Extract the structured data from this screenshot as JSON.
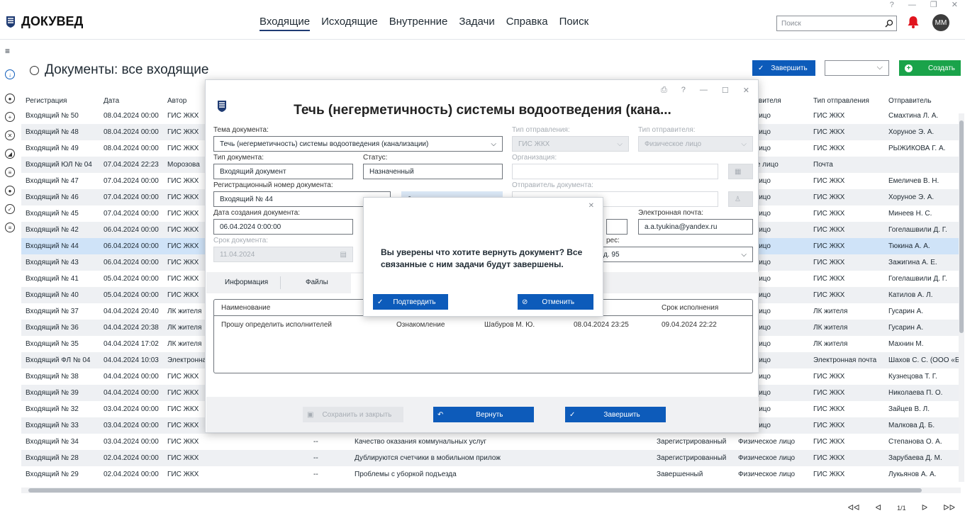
{
  "window": {
    "help": "?",
    "minimize": "—",
    "restore": "❐",
    "close": "✕"
  },
  "app": {
    "title": "ДОКУВЕД"
  },
  "nav": [
    "Входящие",
    "Исходящие",
    "Внутренние",
    "Задачи",
    "Справка",
    "Поиск"
  ],
  "search": {
    "placeholder": "Поиск"
  },
  "user": {
    "initials": "ММ"
  },
  "page": {
    "title": "Документы: все входящие"
  },
  "toolbar": {
    "finish_label": "Завершить",
    "create_label": "Создать"
  },
  "table": {
    "headers": [
      "Регистрация",
      "Дата",
      "Автор",
      "",
      "",
      "",
      "",
      "Отправителя",
      "Тип отправления",
      "Отправитель"
    ],
    "rows": [
      [
        "Входящий № 50",
        "08.04.2024 00:00",
        "ГИС ЖКХ",
        "",
        "",
        "",
        "",
        "ское лицо",
        "ГИС ЖКХ",
        "Смахтина Л. А."
      ],
      [
        "Входящий № 48",
        "08.04.2024 00:00",
        "ГИС ЖКХ",
        "",
        "",
        "",
        "",
        "ское лицо",
        "ГИС ЖКХ",
        "Хоруное Э. А."
      ],
      [
        "Входящий № 49",
        "08.04.2024 00:00",
        "ГИС ЖКХ",
        "",
        "",
        "",
        "",
        "ское лицо",
        "ГИС ЖКХ",
        "РЫЖИКОВА Г. А."
      ],
      [
        "Входящий ЮЛ № 04",
        "07.04.2024 22:23",
        "Морозова",
        "",
        "",
        "",
        "",
        "ческое лицо",
        "Почта",
        ""
      ],
      [
        "Входящий № 47",
        "07.04.2024 00:00",
        "ГИС ЖКХ",
        "",
        "",
        "",
        "",
        "ское лицо",
        "ГИС ЖКХ",
        "Емеличев В. Н."
      ],
      [
        "Входящий № 46",
        "07.04.2024 00:00",
        "ГИС ЖКХ",
        "",
        "",
        "",
        "",
        "ское лицо",
        "ГИС ЖКХ",
        "Хоруное Э. А."
      ],
      [
        "Входящий № 45",
        "07.04.2024 00:00",
        "ГИС ЖКХ",
        "",
        "",
        "",
        "",
        "ское лицо",
        "ГИС ЖКХ",
        "Минеев Н. С."
      ],
      [
        "Входящий № 42",
        "06.04.2024 00:00",
        "ГИС ЖКХ",
        "",
        "",
        "",
        "",
        "ское лицо",
        "ГИС ЖКХ",
        "Гогелашвили Д. Г."
      ],
      [
        "Входящий № 44",
        "06.04.2024 00:00",
        "ГИС ЖКХ",
        "",
        "",
        "",
        "",
        "ское лицо",
        "ГИС ЖКХ",
        "Тюкина А. А."
      ],
      [
        "Входящий № 43",
        "06.04.2024 00:00",
        "ГИС ЖКХ",
        "",
        "",
        "",
        "",
        "ское лицо",
        "ГИС ЖКХ",
        "Зажигина А. Е."
      ],
      [
        "Входящий № 41",
        "05.04.2024 00:00",
        "ГИС ЖКХ",
        "",
        "",
        "",
        "",
        "ское лицо",
        "ГИС ЖКХ",
        "Гогелашвили Д. Г."
      ],
      [
        "Входящий № 40",
        "05.04.2024 00:00",
        "ГИС ЖКХ",
        "",
        "",
        "",
        "",
        "ское лицо",
        "ГИС ЖКХ",
        "Катилов А. Л."
      ],
      [
        "Входящий № 37",
        "04.04.2024 20:40",
        "ЛК жителя",
        "",
        "",
        "",
        "",
        "ское лицо",
        "ЛК жителя",
        "Гусарин А."
      ],
      [
        "Входящий № 36",
        "04.04.2024 20:38",
        "ЛК жителя",
        "",
        "",
        "",
        "",
        "ское лицо",
        "ЛК жителя",
        "Гусарин А."
      ],
      [
        "Входящий № 35",
        "04.04.2024 17:02",
        "ЛК жителя",
        "",
        "",
        "",
        "",
        "ское лицо",
        "ЛК жителя",
        "Махнин М."
      ],
      [
        "Входящий ФЛ № 04",
        "04.04.2024 10:03",
        "Электронна",
        "",
        "",
        "",
        "",
        "ское лицо",
        "Электронная почта",
        "Шахов С. С. (ООО «Б"
      ],
      [
        "Входящий № 38",
        "04.04.2024 00:00",
        "ГИС ЖКХ",
        "",
        "",
        "",
        "",
        "ское лицо",
        "ГИС ЖКХ",
        "Кузнецова Т. Г."
      ],
      [
        "Входящий № 39",
        "04.04.2024 00:00",
        "ГИС ЖКХ",
        "",
        "",
        "",
        "",
        "ское лицо",
        "ГИС ЖКХ",
        "Николаева П. О."
      ],
      [
        "Входящий № 32",
        "03.04.2024 00:00",
        "ГИС ЖКХ",
        "",
        "",
        "",
        "",
        "ское лицо",
        "ГИС ЖКХ",
        "Зайцев В. Л."
      ],
      [
        "Входящий № 33",
        "03.04.2024 00:00",
        "ГИС ЖКХ",
        "",
        "",
        "",
        "",
        "ское лицо",
        "ГИС ЖКХ",
        "Малкова Д. Б."
      ],
      [
        "Входящий № 34",
        "03.04.2024 00:00",
        "ГИС ЖКХ",
        "",
        "--",
        "Качество оказания коммунальных услуг",
        "Зарегистрированный",
        "Физическое лицо",
        "ГИС ЖКХ",
        "Степанова О. А."
      ],
      [
        "Входящий № 28",
        "02.04.2024 00:00",
        "ГИС ЖКХ",
        "",
        "--",
        "Дублируются счетчики в мобильном прилож",
        "Зарегистрированный",
        "Физическое лицо",
        "ГИС ЖКХ",
        "Зарубаева Д. М."
      ],
      [
        "Входящий № 29",
        "02.04.2024 00:00",
        "ГИС ЖКХ",
        "",
        "--",
        "Проблемы с уборкой подъезда",
        "Завершенный",
        "Физическое лицо",
        "ГИС ЖКХ",
        "Лукьянов А. А."
      ]
    ]
  },
  "pager": {
    "first": "ᐊᐊ",
    "prev": "ᐊ",
    "current": "1/1",
    "next": "ᐅ",
    "last": "ᐅᐅ"
  },
  "doc": {
    "title": "Течь (негерметичность) системы водоотведения (кана...",
    "subject_label": "Тема документа:",
    "subject_value": "Течь (негерметичность) системы водоотведения (канализации)",
    "doctype_label": "Тип документа:",
    "doctype_value": "Входящий документ",
    "status_label": "Статус:",
    "status_value": "Назначенный",
    "regnum_label": "Регистрационный номер документа:",
    "regnum_value": "Входящий № 44",
    "created_label": "Дата создания документа:",
    "created_value": "06.04.2024 0:00:00",
    "deadline_label": "Срок документа:",
    "deadline_value": "11.04.2024",
    "send_type_label": "Тип отправления:",
    "send_type_value": "ГИС ЖКХ",
    "sender_type_label": "Тип отправителя:",
    "sender_type_value": "Физическое лицо",
    "org_label": "Организация:",
    "sender_label": "Отправитель документа:",
    "email_label": "Электронная почта:",
    "email_value": "a.a.tyukina@yandex.ru",
    "address_label": "рес:",
    "address_value": "д. 95",
    "tab_info": "Информация",
    "tab_files": "Файлы",
    "task_headers": [
      "Наименование",
      "Срок исполнения"
    ],
    "task_row": [
      "Прошу определить исполнителей",
      "Ознакомление",
      "Шабуров М. Ю.",
      "08.04.2024 23:25",
      "09.04.2024 22:22"
    ],
    "btn_save": "Сохранить и закрыть",
    "btn_return": "Вернуть",
    "btn_finish": "Завершить"
  },
  "confirm": {
    "message": "Вы уверены что хотите вернуть документ? Все связанные с ним задачи будут завершены.",
    "ok": "Подтвердить",
    "cancel": "Отменить",
    "close": "✕"
  },
  "colors": {
    "primary": "#0d5bba",
    "green": "#1aa34a",
    "selected_row": "#cfe3f8",
    "bell": "#e0141e"
  }
}
